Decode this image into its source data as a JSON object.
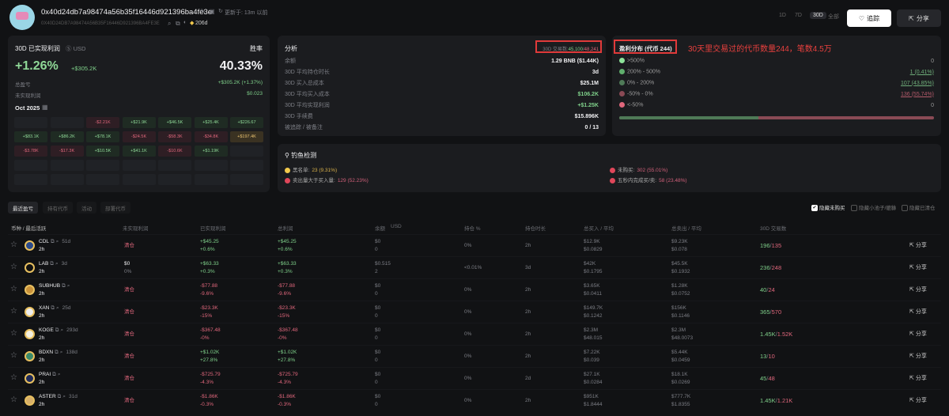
{
  "header": {
    "address": "0x40d24db7a98474a56b35f16446d921396ba4fe3e",
    "address_upper": "0X40D24DB7A98474A56B35F16446D921396BA4FE3E",
    "updated": "更新于: 13m 以前",
    "age": "206d",
    "ranges": [
      "1D",
      "7D",
      "30D",
      "全部"
    ],
    "active_range": "30D",
    "follow_label": "追踪",
    "share_label": "分享"
  },
  "pnl": {
    "title": "30D 已实现利润",
    "currency": "USD",
    "winrate_label": "胜率",
    "pct": "+1.26%",
    "amount": "+$305.2K",
    "winrate": "40.33%",
    "total_label": "总盈亏",
    "total_value": "+$305.2K (+1.37%)",
    "unrealized_label": "未实现利润",
    "unrealized_value": "$0.023",
    "month": "Oct 2025",
    "calendar": [
      [
        "",
        "",
        "-$2.21K",
        "+$21.9K",
        "+$46.5K",
        "+$25.4K",
        "+$226.67"
      ],
      [
        "+$83.1K",
        "+$86.2K",
        "+$78.1K",
        "-$24.5K",
        "-$58.3K",
        "-$34.8K",
        "+$197.4K"
      ],
      [
        "-$3.78K",
        "-$17.3K",
        "+$10.5K",
        "+$41.1K",
        "-$10.6K",
        "+$1.19K",
        ""
      ],
      [
        "",
        "",
        "",
        "",
        "",
        "",
        ""
      ],
      [
        "",
        "",
        "",
        "",
        "",
        "",
        ""
      ]
    ]
  },
  "analysis": {
    "title": "分析",
    "tx_label": "30D 交易数:",
    "tx_buy": "45,100",
    "tx_sell": "48,241",
    "rows": [
      {
        "label": "余额",
        "value": "1.29 BNB ($1.44K)",
        "tone": "w"
      },
      {
        "label": "30D 平均持仓时长",
        "value": "3d",
        "tone": "w"
      },
      {
        "label": "30D 买入总成本",
        "value": "$25.1M",
        "tone": "w"
      },
      {
        "label": "30D 平均买入成本",
        "value": "$106.2K",
        "tone": "g"
      },
      {
        "label": "30D 平均实现利润",
        "value": "+$1.25K",
        "tone": "g"
      },
      {
        "label": "30D 手续费",
        "value": "$15.896K",
        "tone": "w"
      },
      {
        "label": "被追踪 / 被备注",
        "value": "0 / 13",
        "tone": "w"
      }
    ]
  },
  "distribution": {
    "title": "盈利分布 (代币 244)",
    "rows": [
      {
        "label": ">500%",
        "value": "0",
        "color": "#8ee39a"
      },
      {
        "label": "200% - 500%",
        "value": "1 (0.41%)",
        "color": "#5fae6c"
      },
      {
        "label": "0% - 200%",
        "value": "107 (43.85%)",
        "color": "#4f7a57"
      },
      {
        "label": "-50% - 0%",
        "value": "136 (55.74%)",
        "color": "#8a4a55"
      },
      {
        "label": "<-50%",
        "value": "0",
        "color": "#e0677c"
      }
    ],
    "positive_fraction": 0.443
  },
  "annotation": "30天里交易过的代币数量244，笔数4.5万",
  "phishing": {
    "title": "钓鱼检测",
    "items": [
      {
        "label": "黑名单:",
        "value": "23 (9.31%)",
        "color": "#f2c94c"
      },
      {
        "label": "未购买:",
        "value": "302 (55.01%)",
        "color": "#e0475a"
      },
      {
        "label": "卖出量大于买入量:",
        "value": "129 (52.23%)",
        "color": "#e0475a"
      },
      {
        "label": "五秒内完成买/卖:",
        "value": "58 (23.48%)",
        "color": "#e0475a"
      }
    ]
  },
  "tabs": [
    "最近盈亏",
    "持有代币",
    "活动",
    "部署代币"
  ],
  "filters": [
    {
      "label": "隐藏未购买",
      "checked": true
    },
    {
      "label": "隐藏小池子/貔貅",
      "checked": false
    },
    {
      "label": "隐藏已清仓",
      "checked": false
    }
  ],
  "columns": [
    "币种 / 最后活跃",
    "未实现利润",
    "已实现利润",
    "总利润",
    "余额",
    "USD",
    "持仓 %",
    "持仓时长",
    "总买入 / 平均",
    "总卖出 / 平均",
    "30D 交易数"
  ],
  "rows": [
    {
      "sym": "CDL",
      "age": "51d",
      "last": "2h",
      "unreal": "清仓",
      "unreal2": "",
      "real": "+$45.25",
      "realp": "+0.6%",
      "tot": "+$45.25",
      "totp": "+0.6%",
      "bal": "$0",
      "bal2": "0",
      "hold": "0%",
      "dur": "2h",
      "buy": "$12.9K",
      "buyavg": "$0.0829",
      "sell": "$9.23K",
      "sellavg": "$0.078",
      "tb": "196",
      "ts": "135",
      "color": "#2a4a8a"
    },
    {
      "sym": "LAB",
      "age": "3d",
      "last": "2h",
      "unreal": "$0",
      "unreal2": "0%",
      "real": "+$63.33",
      "realp": "+0.3%",
      "tot": "+$63.33",
      "totp": "+0.3%",
      "bal": "$0.515",
      "bal2": "2",
      "hold": "<0.01%",
      "dur": "3d",
      "buy": "$42K",
      "buyavg": "$0.1795",
      "sell": "$45.5K",
      "sellavg": "$0.1932",
      "tb": "236",
      "ts": "248",
      "color": "#111"
    },
    {
      "sym": "SUBHUB",
      "age": "",
      "last": "2h",
      "unreal": "清仓",
      "unreal2": "",
      "real": "-$77.88",
      "realp": "-9.6%",
      "tot": "-$77.88",
      "totp": "-9.6%",
      "bal": "$0",
      "bal2": "0",
      "hold": "0%",
      "dur": "2h",
      "buy": "$3.65K",
      "buyavg": "$0.0411",
      "sell": "$1.28K",
      "sellavg": "$0.0752",
      "tb": "40",
      "ts": "24",
      "color": "#c8913a"
    },
    {
      "sym": "XAN",
      "age": "25d",
      "last": "2h",
      "unreal": "清仓",
      "unreal2": "",
      "real": "-$23.3K",
      "realp": "-15%",
      "tot": "-$23.3K",
      "totp": "-15%",
      "bal": "$0",
      "bal2": "0",
      "hold": "0%",
      "dur": "2h",
      "buy": "$149.7K",
      "buyavg": "$0.1242",
      "sell": "$156K",
      "sellavg": "$0.1146",
      "tb": "365",
      "ts": "570",
      "color": "#eee"
    },
    {
      "sym": "KOGE",
      "age": "293d",
      "last": "2h",
      "unreal": "清仓",
      "unreal2": "",
      "real": "-$367.48",
      "realp": "-0%",
      "tot": "-$367.48",
      "totp": "-0%",
      "bal": "$0",
      "bal2": "0",
      "hold": "0%",
      "dur": "2h",
      "buy": "$2.3M",
      "buyavg": "$48.015",
      "sell": "$2.3M",
      "sellavg": "$48.0073",
      "tb": "1.45K",
      "ts": "1.52K",
      "color": "#f4f0e0"
    },
    {
      "sym": "BDXN",
      "age": "138d",
      "last": "2h",
      "unreal": "清仓",
      "unreal2": "",
      "real": "+$1.02K",
      "realp": "+27.8%",
      "tot": "+$1.02K",
      "totp": "+27.8%",
      "bal": "$0",
      "bal2": "0",
      "hold": "0%",
      "dur": "2h",
      "buy": "$7.22K",
      "buyavg": "$0.039",
      "sell": "$5.44K",
      "sellavg": "$0.0459",
      "tb": "13",
      "ts": "10",
      "color": "#3a8a6a"
    },
    {
      "sym": "PRAI",
      "age": "",
      "last": "2h",
      "unreal": "清仓",
      "unreal2": "",
      "real": "-$725.79",
      "realp": "-4.3%",
      "tot": "-$725.79",
      "totp": "-4.3%",
      "bal": "$0",
      "bal2": "0",
      "hold": "0%",
      "dur": "2d",
      "buy": "$27.1K",
      "buyavg": "$0.0284",
      "sell": "$18.1K",
      "sellavg": "$0.0269",
      "tb": "45",
      "ts": "48",
      "color": "#1e2a5a"
    },
    {
      "sym": "ASTER",
      "age": "31d",
      "last": "2h",
      "unreal": "清仓",
      "unreal2": "",
      "real": "-$1.86K",
      "realp": "-0.3%",
      "tot": "-$1.86K",
      "totp": "-0.3%",
      "bal": "$0",
      "bal2": "0",
      "hold": "0%",
      "dur": "2h",
      "buy": "$951K",
      "buyavg": "$1.8444",
      "sell": "$777.7K",
      "sellavg": "$1.8355",
      "tb": "1.45K",
      "ts": "1.21K",
      "color": "#d8b06a"
    }
  ],
  "share_label": "分享"
}
